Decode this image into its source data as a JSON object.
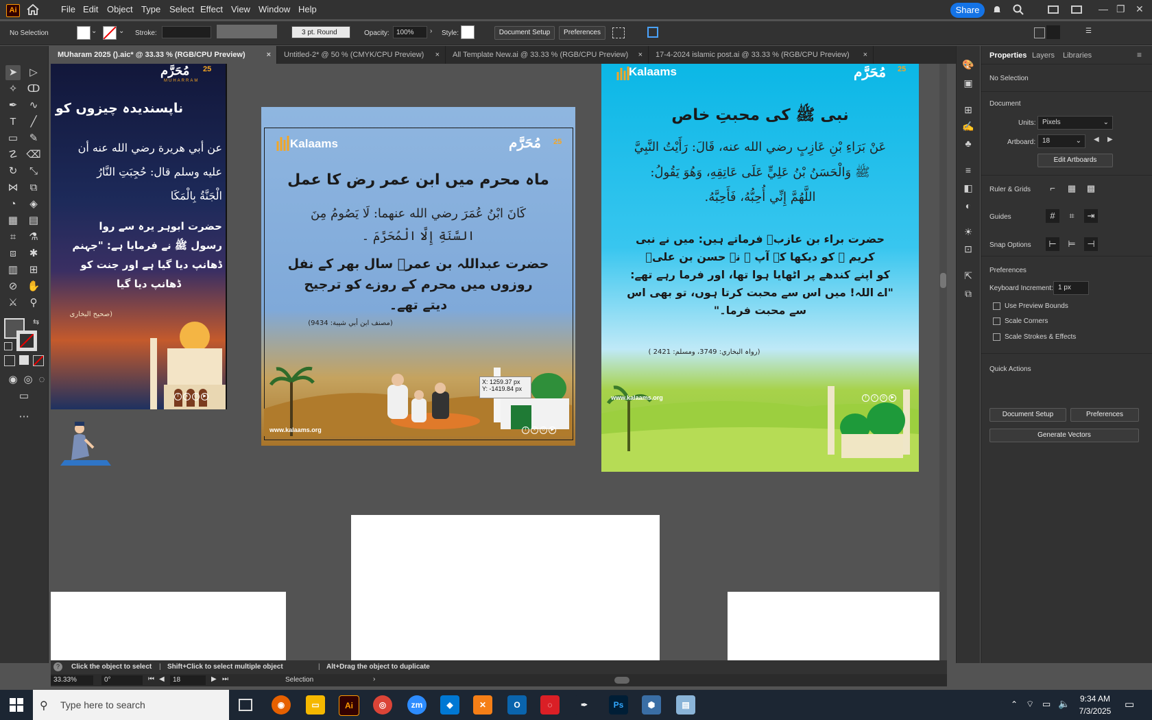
{
  "app": {
    "logo": "Ai"
  },
  "menu": [
    "File",
    "Edit",
    "Object",
    "Type",
    "Select",
    "Effect",
    "View",
    "Window",
    "Help"
  ],
  "topright": {
    "share": "Share"
  },
  "controlbar": {
    "selection": "No Selection",
    "stroke_label": "Stroke:",
    "brush": "3 pt. Round",
    "opacity_label": "Opacity:",
    "opacity": "100%",
    "style_label": "Style:",
    "document_setup": "Document Setup",
    "preferences": "Preferences"
  },
  "tabs": [
    {
      "label": "MUharam 2025 ().aic* @ 33.33 % (RGB/CPU Preview)",
      "close": "×"
    },
    {
      "label": "Untitled-2* @ 50 % (CMYK/CPU Preview)",
      "close": "×"
    },
    {
      "label": "All Template New.ai @ 33.33 % (RGB/CPU Preview)",
      "close": "×"
    },
    {
      "label": "17-4-2024 islamic post.ai @ 33.33 % (RGB/CPU Preview)",
      "close": "×"
    }
  ],
  "artboard_left": {
    "title": "ناپسندیدہ چیزوں کو",
    "arabic1": "عن أبي هريرة رضي الله عنه أن",
    "arabic2": "عليه وسلم قال: حُجِبَتِ النَّارُ",
    "arabic3": "الْجَنَّةُ بِالْمَكَا",
    "urdu1": "حضرت ابوہر یرہ سے روا",
    "urdu2": "رسول ﷺ نے فرمایا ہے: \"جہنم",
    "urdu3": "ڈھانپ دیا گیا ہے اور جنت کو",
    "urdu4": "ڈھانپ دیا گیا",
    "ref": "(صحیح البخاری",
    "logo": "مُحَرَّم",
    "logo_sub": "MUHARRAM",
    "badge": "25"
  },
  "artboard_center": {
    "brand": "Kalaams",
    "logo": "مُحَرَّم",
    "badge": "25",
    "title": "ماہ محرم میں ابن عمر رض کا عمل",
    "arabic1": "كَانَ ابْنُ عُمَرَ رضي الله عنهما: لَا يَصُومُ مِنَ",
    "arabic2": "السَّنَةِ إِلَّا الْمُحَرَّمَ ۔",
    "urdu1": "حضرت عبداللہ بن عمرؓ سال بھر کے نفل",
    "urdu2": "روزوں میں محرم کے روزے کو ترجیح",
    "urdu3": "دیتے تھے۔",
    "ref": "(مصنف ابن أبي شيبة: 9434)",
    "website": "www.kalaams.org"
  },
  "artboard_right": {
    "brand": "Kalaams",
    "logo": "مُحَرَّم",
    "badge": "25",
    "title": "نبی ﷺ کی محبتِ خاص",
    "arabic1": "عَنْ بَرَاءِ بْنِ عَازِبٍ رضي الله عنه، قَالَ: رَأَيْتُ النَّبِيَّ",
    "arabic2": "ﷺ وَالْحَسَنُ بْنُ عَلِيٍّ عَلَى عَاتِقِهِ، وَهُوَ يَقُولُ:",
    "arabic3": "اللَّهُمَّ إِنِّي أُحِبُّهُ، فَأَحِبَّهُ.",
    "urdu1": "حضرت براء بن عازبؓ فرماتے ہیں: میں نے نبی",
    "urdu2": "کریم ﷺ کو دیکھا کہ آپ ﷺ نے حسن بن علیؓ",
    "urdu3": "کو اپنے کندھے پر اٹھایا ہوا تھا، اور فرما رہے تھے:",
    "urdu4": "\"اے اللہ! میں اس سے محبت کرتا ہوں، تو بھی اس",
    "urdu5": "سے محبت فرما۔\"",
    "ref": "(رواہ البخاري: 3749، ومسلم: 2421 )",
    "website": "www.kalaams.org"
  },
  "cursor_tooltip": {
    "x": "X: 1259.37 px",
    "y": "Y: -1419.84 px"
  },
  "properties": {
    "tabs": [
      "Properties",
      "Layers",
      "Libraries"
    ],
    "selection": "No Selection",
    "document_heading": "Document",
    "units_label": "Units:",
    "units_value": "Pixels",
    "artboard_label": "Artboard:",
    "artboard_value": "18",
    "edit_artboards": "Edit Artboards",
    "rulers_label": "Ruler & Grids",
    "guides_label": "Guides",
    "snap_label": "Snap Options",
    "preferences_heading": "Preferences",
    "keyboard_increment_label": "Keyboard Increment:",
    "keyboard_increment": "1 px",
    "use_preview_bounds": "Use Preview Bounds",
    "scale_corners": "Scale Corners",
    "scale_strokes": "Scale Strokes & Effects",
    "quick_actions": "Quick Actions",
    "document_setup": "Document Setup",
    "preferences": "Preferences",
    "generate_vectors": "Generate Vectors"
  },
  "status": {
    "hint1": "Click the object to select",
    "hint2": "Shift+Click to select multiple object",
    "hint3": "Alt+Drag the object to duplicate",
    "zoom": "33.33%",
    "rotation": "0°",
    "artboard_nav": "18",
    "tool": "Selection"
  },
  "taskbar": {
    "search_placeholder": "Type here to search",
    "time": "9:34 AM",
    "date": "7/3/2025"
  }
}
